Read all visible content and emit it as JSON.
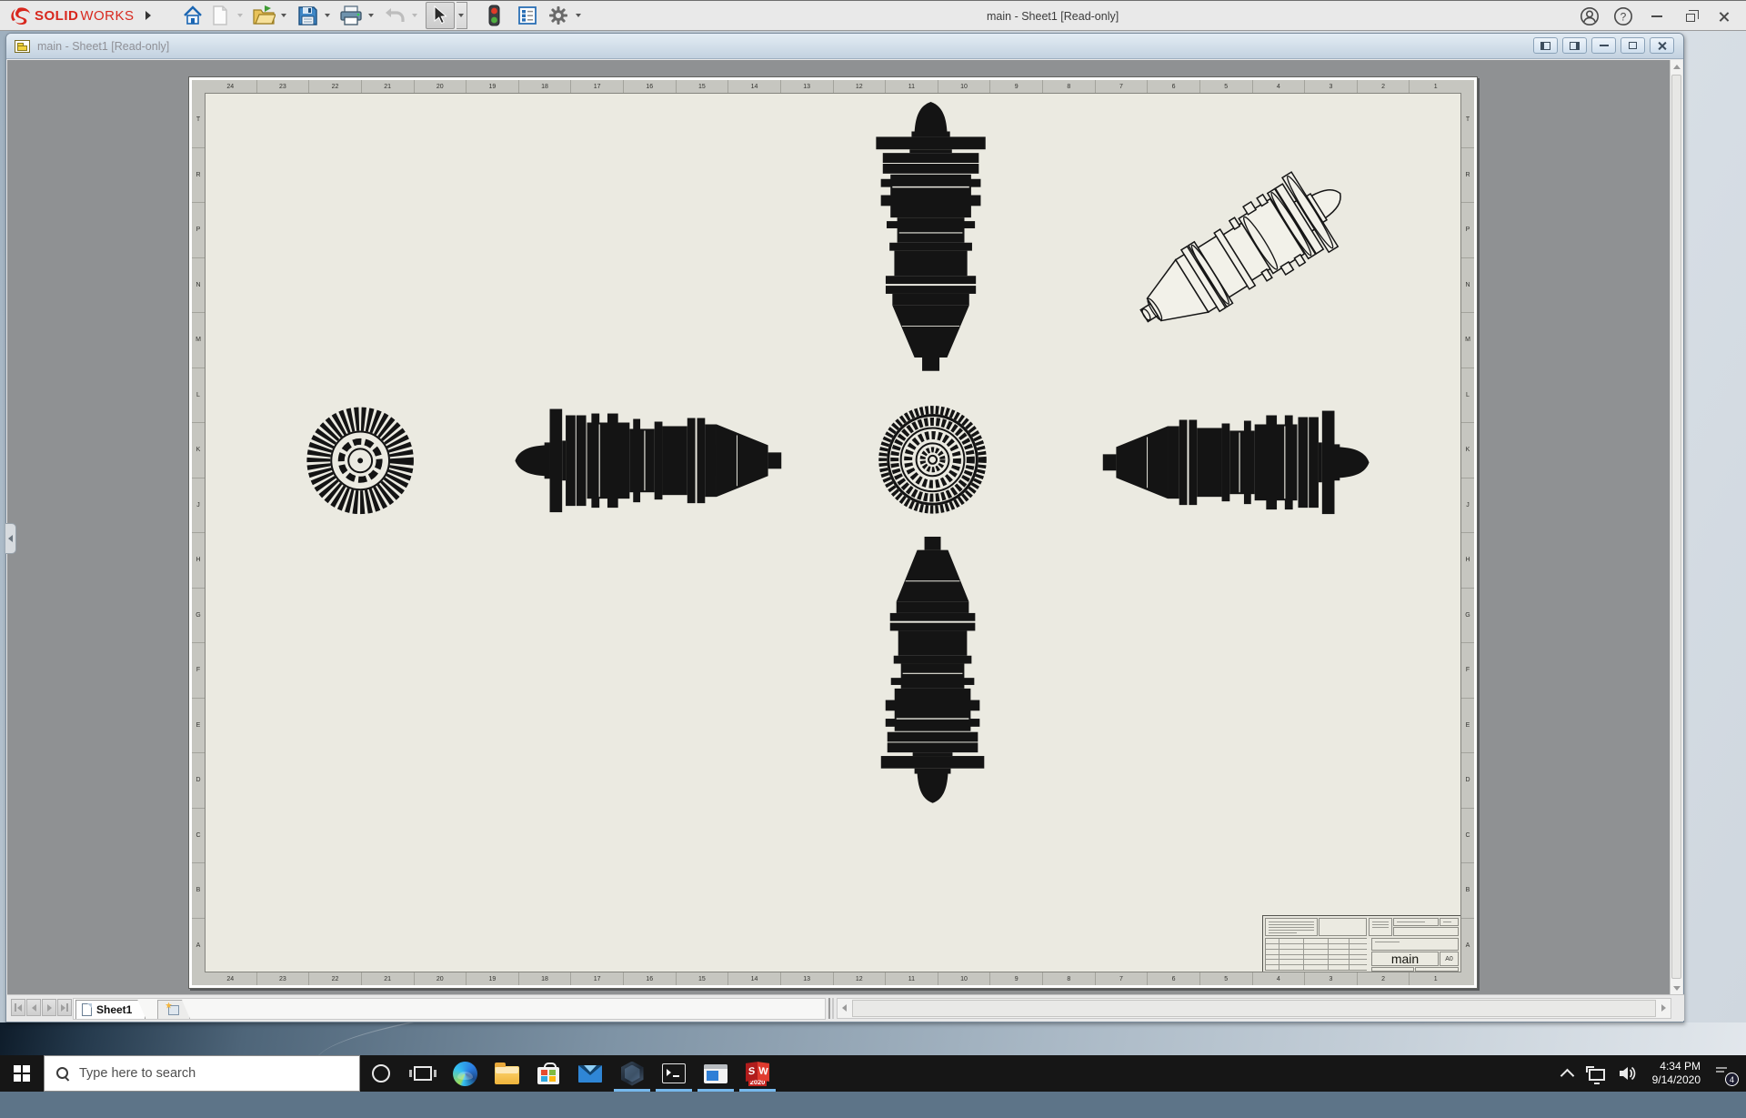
{
  "app": {
    "titlebar": {
      "title": "main - Sheet1 [Read-only]",
      "logo": {
        "part1": "SOLID",
        "part2": "WORKS"
      },
      "help_glyph": "?"
    },
    "colors": {
      "logo_red": "#d8271d",
      "canvas_gray": "#8f9193",
      "sheet_ivory": "#ebeae1",
      "doc_titlebar_blue": "#c3d2e0",
      "taskbar_black": "#161616",
      "running_indicator": "#76b9ed"
    }
  },
  "document": {
    "titlebar_title": "main - Sheet1 [Read-only]",
    "sheet": {
      "zone_numbers": [
        "24",
        "23",
        "22",
        "21",
        "20",
        "19",
        "18",
        "17",
        "16",
        "15",
        "14",
        "13",
        "12",
        "11",
        "10",
        "9",
        "8",
        "7",
        "6",
        "5",
        "4",
        "3",
        "2",
        "1"
      ],
      "zone_letters": [
        "T",
        "R",
        "P",
        "N",
        "M",
        "L",
        "K",
        "J",
        "H",
        "G",
        "F",
        "E",
        "D",
        "C",
        "B",
        "A"
      ],
      "title_block": {
        "drawing_title": "main",
        "sheet_size": "A0"
      }
    },
    "bottom_bar": {
      "sheet_tab_label": "Sheet1"
    }
  },
  "taskbar": {
    "search_placeholder": "Type here to search",
    "solidworks_icon": {
      "left_letter": "S",
      "right_letter": "W",
      "year": "2020"
    },
    "tray": {
      "time": "4:34 PM",
      "date": "9/14/2020",
      "notification_count": "4"
    }
  }
}
